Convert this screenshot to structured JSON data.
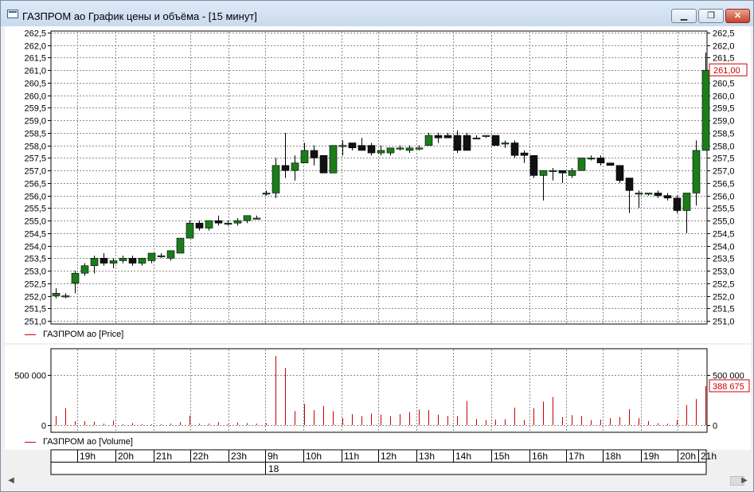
{
  "window": {
    "title": "ГАЗПРОМ ао График цены и объёма - [15 минут]",
    "minimize_glyph": "▁",
    "restore_glyph": "❐",
    "close_glyph": "✕"
  },
  "price_pane": {
    "legend": "ГАЗПРОМ ао [Price]",
    "y_ticks": [
      "262,5",
      "262,0",
      "261,5",
      "261,0",
      "260,5",
      "260,0",
      "259,5",
      "259,0",
      "258,5",
      "258,0",
      "257,5",
      "257,0",
      "256,5",
      "256,0",
      "255,5",
      "255,0",
      "254,5",
      "254,0",
      "253,5",
      "253,0",
      "252,5",
      "252,0",
      "251,5",
      "251,0"
    ],
    "current_label": "261,00",
    "current_value": 261.0
  },
  "volume_pane": {
    "legend": "ГАЗПРОМ ао [Volume]",
    "y_ticks": [
      "500 000",
      "0"
    ],
    "current_label": "388 675",
    "current_value": 388675
  },
  "time_axis": {
    "hours": [
      "19h",
      "20h",
      "21h",
      "22h",
      "23h",
      "9h",
      "10h",
      "11h",
      "12h",
      "13h",
      "14h",
      "15h",
      "16h",
      "17h",
      "18h",
      "19h",
      "20h",
      "21h"
    ],
    "day": "18"
  },
  "colors": {
    "up": "#1a7d1a",
    "down": "#111111",
    "volume": "#cc0000",
    "grid": "#8a8a8a"
  },
  "scrollbar": {
    "left_arrow": "◀",
    "right_arrow": "▶"
  },
  "chart_data": {
    "type": "candlestick",
    "title": "ГАЗПРОМ ао График цены и объёма - [15 минут]",
    "timeframe": "15 минут",
    "ylim": [
      251.0,
      262.5
    ],
    "candles": [
      [
        252.0,
        252.3,
        251.9,
        252.1
      ],
      [
        252.0,
        252.1,
        251.9,
        252.0
      ],
      [
        252.5,
        253.0,
        252.1,
        252.9
      ],
      [
        252.9,
        253.3,
        252.8,
        253.2
      ],
      [
        253.2,
        253.6,
        252.9,
        253.5
      ],
      [
        253.5,
        253.7,
        253.2,
        253.3
      ],
      [
        253.3,
        253.5,
        253.1,
        253.4
      ],
      [
        253.4,
        253.6,
        253.3,
        253.5
      ],
      [
        253.5,
        253.6,
        253.2,
        253.3
      ],
      [
        253.3,
        253.5,
        253.2,
        253.5
      ],
      [
        253.4,
        253.7,
        253.3,
        253.7
      ],
      [
        253.6,
        253.7,
        253.5,
        253.6
      ],
      [
        253.5,
        253.8,
        253.4,
        253.8
      ],
      [
        253.7,
        254.3,
        253.7,
        254.3
      ],
      [
        254.3,
        255.0,
        254.3,
        254.9
      ],
      [
        254.9,
        255.0,
        254.6,
        254.7
      ],
      [
        254.7,
        255.0,
        254.6,
        255.0
      ],
      [
        255.0,
        255.2,
        254.8,
        254.9
      ],
      [
        254.9,
        255.0,
        254.8,
        254.9
      ],
      [
        254.9,
        255.1,
        254.8,
        255.0
      ],
      [
        255.0,
        255.2,
        254.9,
        255.2
      ],
      [
        255.1,
        255.2,
        255.1,
        255.1
      ],
      [
        256.1,
        256.2,
        256.0,
        256.1
      ],
      [
        256.1,
        257.5,
        255.9,
        257.2
      ],
      [
        257.2,
        258.5,
        256.7,
        257.0
      ],
      [
        257.0,
        257.6,
        256.6,
        257.3
      ],
      [
        257.3,
        258.1,
        257.3,
        257.8
      ],
      [
        257.8,
        258.0,
        257.2,
        257.5
      ],
      [
        257.6,
        257.6,
        256.9,
        256.9
      ],
      [
        256.9,
        258.0,
        256.9,
        258.0
      ],
      [
        258.0,
        258.2,
        257.6,
        258.0
      ],
      [
        258.1,
        258.1,
        257.8,
        257.9
      ],
      [
        258.0,
        258.3,
        257.8,
        257.8
      ],
      [
        258.0,
        258.1,
        257.6,
        257.7
      ],
      [
        257.7,
        258.0,
        257.6,
        257.8
      ],
      [
        257.7,
        257.9,
        257.6,
        257.9
      ],
      [
        257.9,
        258.0,
        257.8,
        257.9
      ],
      [
        257.8,
        258.0,
        257.7,
        257.9
      ],
      [
        257.9,
        258.0,
        257.8,
        257.9
      ],
      [
        258.0,
        258.5,
        258.0,
        258.4
      ],
      [
        258.4,
        258.5,
        258.1,
        258.3
      ],
      [
        258.4,
        258.5,
        258.3,
        258.3
      ],
      [
        258.4,
        258.6,
        257.7,
        257.8
      ],
      [
        258.4,
        258.5,
        257.8,
        257.8
      ],
      [
        258.3,
        258.4,
        258.3,
        258.3
      ],
      [
        258.4,
        258.4,
        258.3,
        258.4
      ],
      [
        258.4,
        258.4,
        258.0,
        258.0
      ],
      [
        258.1,
        258.2,
        257.9,
        258.1
      ],
      [
        258.1,
        258.2,
        257.5,
        257.6
      ],
      [
        257.7,
        257.8,
        257.3,
        257.6
      ],
      [
        257.6,
        257.6,
        256.7,
        256.8
      ],
      [
        256.8,
        257.0,
        255.8,
        257.0
      ],
      [
        257.0,
        257.1,
        256.6,
        257.0
      ],
      [
        257.0,
        257.0,
        256.5,
        256.9
      ],
      [
        256.8,
        257.1,
        256.7,
        257.0
      ],
      [
        257.0,
        257.5,
        257.0,
        257.5
      ],
      [
        257.5,
        257.6,
        257.4,
        257.5
      ],
      [
        257.5,
        257.6,
        257.2,
        257.3
      ],
      [
        257.3,
        257.3,
        257.2,
        257.2
      ],
      [
        257.2,
        257.2,
        256.5,
        256.6
      ],
      [
        256.7,
        256.7,
        255.3,
        256.2
      ],
      [
        256.1,
        256.2,
        255.5,
        256.1
      ],
      [
        256.1,
        256.1,
        256.0,
        256.1
      ],
      [
        256.1,
        256.2,
        255.9,
        256.0
      ],
      [
        256.0,
        256.1,
        255.8,
        255.9
      ],
      [
        255.9,
        256.0,
        255.3,
        255.4
      ],
      [
        255.4,
        256.1,
        254.5,
        256.1
      ],
      [
        256.1,
        258.2,
        255.6,
        257.8
      ],
      [
        257.8,
        261.7,
        257.8,
        261.0
      ]
    ],
    "volumes": [
      90000,
      170000,
      40000,
      40000,
      35000,
      15000,
      45000,
      10000,
      20000,
      10000,
      10000,
      10000,
      15000,
      30000,
      95000,
      15000,
      15000,
      30000,
      10000,
      25000,
      20000,
      15000,
      20000,
      690000,
      570000,
      140000,
      210000,
      150000,
      190000,
      140000,
      70000,
      110000,
      90000,
      115000,
      105000,
      90000,
      110000,
      130000,
      155000,
      150000,
      105000,
      90000,
      90000,
      240000,
      60000,
      50000,
      55000,
      60000,
      175000,
      50000,
      170000,
      235000,
      280000,
      80000,
      100000,
      90000,
      50000,
      55000,
      70000,
      80000,
      160000,
      70000,
      40000,
      20000,
      15000,
      50000,
      200000,
      260000,
      388675
    ],
    "hour_labels": [
      "19h",
      "20h",
      "21h",
      "22h",
      "23h",
      "9h",
      "10h",
      "11h",
      "12h",
      "13h",
      "14h",
      "15h",
      "16h",
      "17h",
      "18h",
      "19h",
      "20h",
      "21h"
    ],
    "date_label": "18"
  }
}
